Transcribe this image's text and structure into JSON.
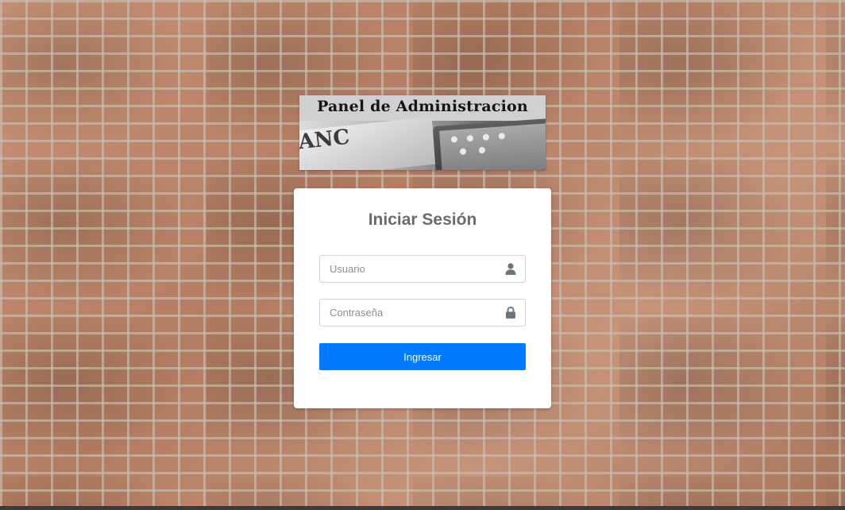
{
  "banner": {
    "title": "Panel de Administracion",
    "image_text": "ANC"
  },
  "login": {
    "heading": "Iniciar Sesión",
    "username_placeholder": "Usuario",
    "username_value": "",
    "password_placeholder": "Contraseña",
    "password_value": "",
    "submit_label": "Ingresar"
  },
  "icons": {
    "username": "user-icon",
    "password": "lock-icon"
  },
  "colors": {
    "button": "#007bff",
    "heading": "#6b6b6b",
    "card": "#ffffff"
  }
}
